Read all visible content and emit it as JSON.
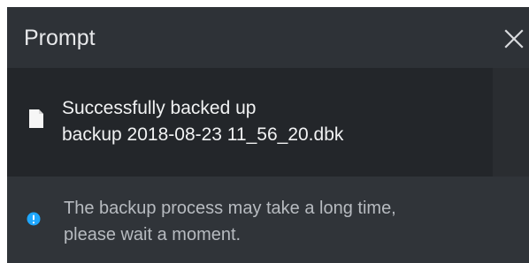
{
  "dialog": {
    "title": "Prompt",
    "close_icon": "close-icon"
  },
  "file": {
    "icon": "document-icon",
    "message": "Successfully backed up",
    "filename": "backup 2018-08-23 11_56_20.dbk",
    "folder_icon": "folder-icon"
  },
  "notice": {
    "icon": "info-icon",
    "line1": "The backup process may take a long time,",
    "line2": "please wait a moment."
  },
  "colors": {
    "titlebar": "#2e3237",
    "file_panel": "#23262a",
    "notice_panel": "#303439",
    "info_accent": "#1ea7ff",
    "primary_text": "#f1f2f3",
    "secondary_text": "#b7bbc0"
  }
}
